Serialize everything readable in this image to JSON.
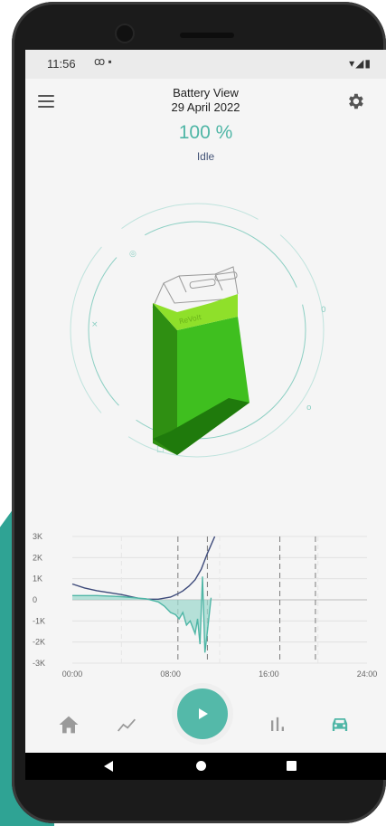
{
  "status_bar": {
    "time": "11:56",
    "icons_left": "ꝏ ▪",
    "icons_right": "▾◢▮"
  },
  "header": {
    "title": "Battery View",
    "date": "29 April 2022"
  },
  "battery": {
    "percent_text": "100 %",
    "state": "Idle",
    "level": 1.0
  },
  "colors": {
    "accent": "#4fb6a6",
    "battery_green": "#3fbf1f",
    "line_navy": "#3d4a7a"
  },
  "chart_data": {
    "type": "line",
    "title": "",
    "xlabel": "",
    "ylabel": "",
    "x_ticks": [
      "00:00",
      "08:00",
      "16:00",
      "24:00"
    ],
    "y_ticks": [
      "3K",
      "2K",
      "1K",
      "0",
      "-1K",
      "-2K",
      "-3K"
    ],
    "ylim": [
      -3000,
      3000
    ],
    "xlim": [
      0,
      24
    ],
    "series": [
      {
        "color": "#3d4a7a",
        "points": [
          [
            0,
            750
          ],
          [
            1,
            560
          ],
          [
            2,
            430
          ],
          [
            3,
            340
          ],
          [
            4,
            250
          ],
          [
            5,
            120
          ],
          [
            5.5,
            60
          ],
          [
            6,
            30
          ],
          [
            7,
            30
          ],
          [
            8,
            130
          ],
          [
            8.5,
            260
          ],
          [
            9,
            420
          ],
          [
            9.5,
            650
          ],
          [
            10,
            950
          ],
          [
            10.5,
            1450
          ],
          [
            11,
            2200
          ],
          [
            11.6,
            3000
          ]
        ]
      },
      {
        "color": "#4fb6a6",
        "points": [
          [
            0,
            200
          ],
          [
            2,
            200
          ],
          [
            4,
            150
          ],
          [
            5,
            100
          ],
          [
            6,
            50
          ],
          [
            7,
            -100
          ],
          [
            7.5,
            -300
          ],
          [
            8,
            -600
          ],
          [
            8.4,
            -700
          ],
          [
            8.7,
            -900
          ],
          [
            9,
            -600
          ],
          [
            9.3,
            -1200
          ],
          [
            9.6,
            -1000
          ],
          [
            10,
            -1600
          ],
          [
            10.2,
            -900
          ],
          [
            10.4,
            -2100
          ],
          [
            10.6,
            1100
          ],
          [
            10.8,
            -2500
          ],
          [
            11,
            -1500
          ],
          [
            11.3,
            100
          ]
        ]
      }
    ],
    "vertical_markers": [
      8.6,
      11.0,
      16.9,
      19.8
    ]
  },
  "bottom_nav": {
    "items": [
      {
        "icon": "home-icon"
      },
      {
        "icon": "trend-icon"
      },
      {
        "icon": "play-icon"
      },
      {
        "icon": "bar-chart-icon"
      },
      {
        "icon": "car-icon",
        "active": true
      }
    ]
  }
}
